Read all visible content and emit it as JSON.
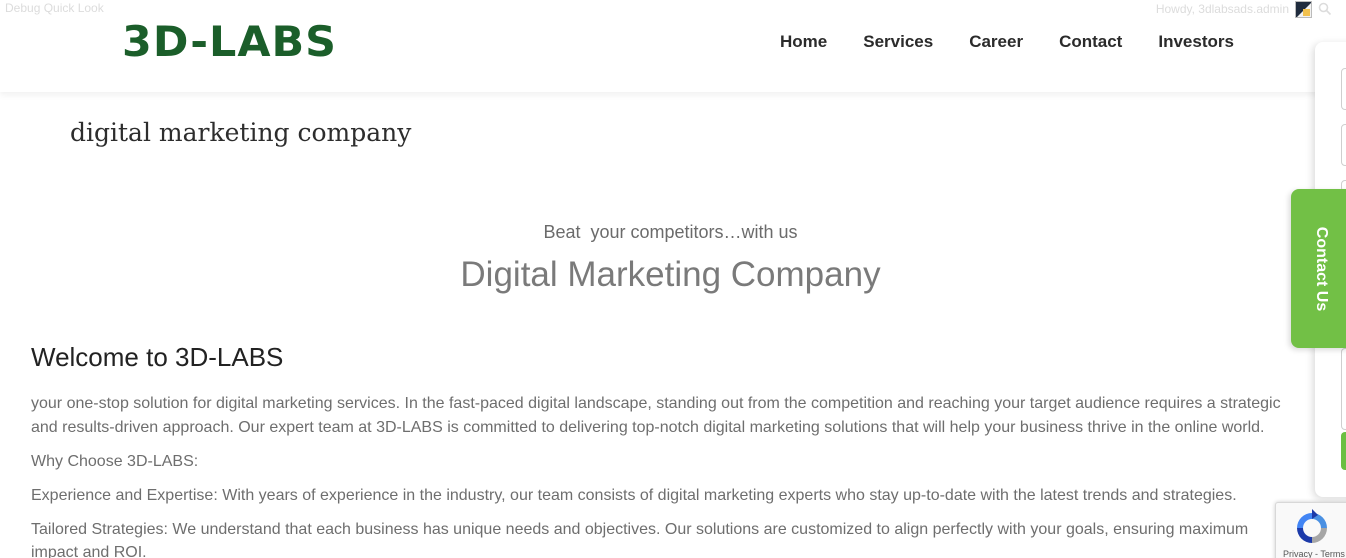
{
  "admin_bar": {
    "left_text": "Debug Quick Look",
    "greeting": "Howdy, 3dlabsads.admin"
  },
  "header": {
    "logo_text": "3D-LABS",
    "nav": [
      {
        "label": "Home"
      },
      {
        "label": "Services"
      },
      {
        "label": "Career"
      },
      {
        "label": "Contact"
      },
      {
        "label": "Investors"
      }
    ]
  },
  "page": {
    "title": "digital marketing company"
  },
  "hero": {
    "tagline": "Beat  your competitors…with us",
    "heading": "Digital Marketing Company"
  },
  "content": {
    "heading": "Welcome to 3D-LABS",
    "paragraphs": [
      "your one-stop solution for digital marketing services. In the fast-paced digital landscape, standing out from the competition and reaching your target audience requires a strategic and results-driven approach. Our expert team at 3D-LABS is committed to delivering top-notch digital marketing solutions that will help your business thrive in the online world.",
      "Why Choose 3D-LABS:",
      "Experience and Expertise: With years of experience in the industry, our team consists of digital marketing experts who stay up-to-date with the latest trends and strategies.",
      "Tailored Strategies: We understand that each business has unique needs and objectives. Our solutions are customized to align perfectly with your goals, ensuring maximum impact and ROI."
    ]
  },
  "contact_tab": {
    "label": "Contact Us"
  },
  "recaptcha": {
    "text": "Privacy - Terms"
  },
  "colors": {
    "brand_green": "#1b5e2a",
    "accent_green": "#72c046"
  },
  "icons": {
    "search": "search-icon",
    "avatar": "avatar",
    "recaptcha": "recaptcha-icon"
  }
}
